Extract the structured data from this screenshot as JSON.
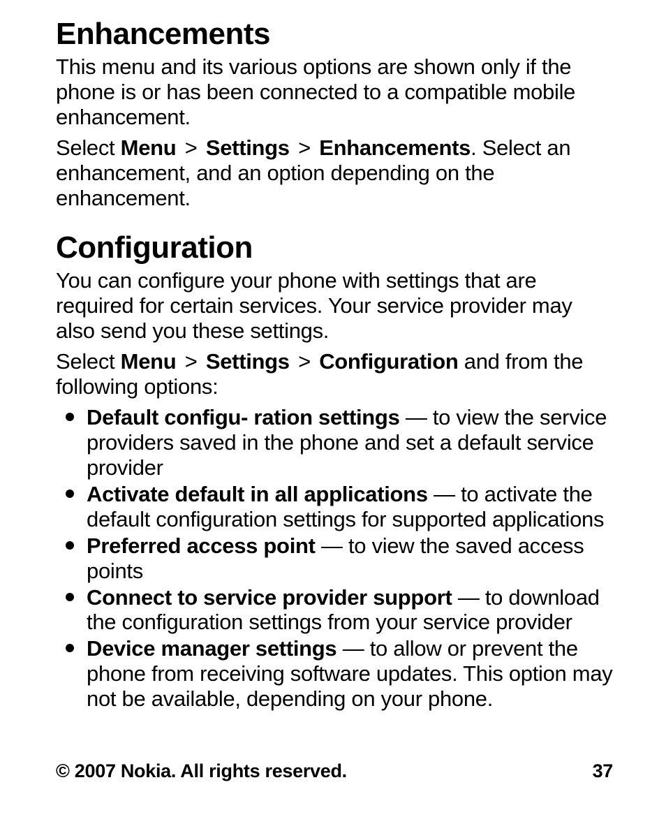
{
  "sections": [
    {
      "heading": "Enhancements",
      "paras": [
        {
          "runs": [
            {
              "t": "This menu and its various options are shown only if the phone is or has been connected to a compatible mobile enhancement."
            }
          ]
        },
        {
          "runs": [
            {
              "t": "Select "
            },
            {
              "t": "Menu",
              "b": true
            },
            {
              "t": "  >  ",
              "gt": true
            },
            {
              "t": "Settings",
              "b": true
            },
            {
              "t": "  >  ",
              "gt": true
            },
            {
              "t": "Enhancements",
              "b": true
            },
            {
              "t": ". Select an enhancement, and an option depending on the enhancement."
            }
          ]
        }
      ]
    },
    {
      "heading": "Configuration",
      "paras": [
        {
          "runs": [
            {
              "t": "You can configure your phone with settings that are required for certain services. Your service provider may also send you these settings."
            }
          ]
        },
        {
          "runs": [
            {
              "t": "Select "
            },
            {
              "t": "Menu",
              "b": true
            },
            {
              "t": "  >  ",
              "gt": true
            },
            {
              "t": "Settings",
              "b": true
            },
            {
              "t": "  >  ",
              "gt": true
            },
            {
              "t": "Configuration",
              "b": true
            },
            {
              "t": " and from the following options:"
            }
          ]
        }
      ],
      "list": [
        {
          "runs": [
            {
              "t": "Default configu- ration settings",
              "b": true
            },
            {
              "t": "  — to view the service providers saved in the phone and set a default service provider"
            }
          ]
        },
        {
          "runs": [
            {
              "t": "Activate default in all applications",
              "b": true
            },
            {
              "t": "  — to activate the default configuration settings for supported applications"
            }
          ]
        },
        {
          "runs": [
            {
              "t": "Preferred access point",
              "b": true
            },
            {
              "t": "  — to view the saved access points"
            }
          ]
        },
        {
          "runs": [
            {
              "t": "Connect to service provider support",
              "b": true
            },
            {
              "t": "  — to download the configuration settings from your service provider"
            }
          ]
        },
        {
          "runs": [
            {
              "t": "Device manager settings",
              "b": true
            },
            {
              "t": "  — to allow or prevent the phone from receiving software updates. This option may not be available, depending on your phone."
            }
          ]
        }
      ]
    }
  ],
  "footer": {
    "copyright": "© 2007 Nokia. All rights reserved.",
    "page_number": "37"
  }
}
